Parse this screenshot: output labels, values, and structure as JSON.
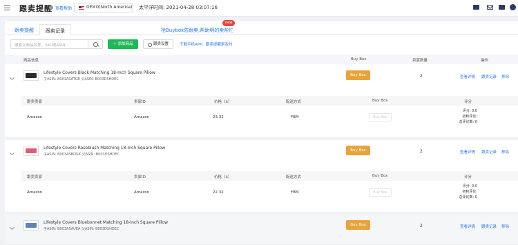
{
  "header": {
    "app_title": "跟卖提醒",
    "help_link": "查看帮助",
    "region": "DEMO(North America)",
    "time_label": "太平洋时间: 2021-04-28 03:07:16"
  },
  "tabs": [
    {
      "label": "跟卖提醒"
    },
    {
      "label": "跟卖记录"
    }
  ],
  "promo": {
    "text": "抢Buybox防跟卖,帮助明的卖帮忙",
    "badge": "new"
  },
  "toolbar": {
    "search_placeholder": "搜索父商品名称、SKU或ASIN",
    "add_button": "添加商品",
    "settings_button": "跟卖设置",
    "app_link": "下载手机APP，跟卖提醒更及时"
  },
  "table_headers": {
    "product_info": "商品信息",
    "buy_box": "Buy Box",
    "seller_count": "卖家数量",
    "actions": "操作"
  },
  "sub_headers": {
    "seller": "跟卖卖家",
    "seller_id": "卖家ID",
    "price": "价格（$）",
    "shipping": "配送方式",
    "buy_box": "Buy Box",
    "rating": "评分"
  },
  "products": [
    {
      "title": "Lifestyle Covers Black Matching 18-Inch Square Pillow",
      "asins": "子ASIN: B003ASATGE   父ASIN: B003DSHDEC",
      "buybox": "Buy Box",
      "seller_count": "2",
      "op_detail": "查看详情",
      "op_record": "跟卖记录",
      "op_remove": "移除",
      "pillow_color": "#2a2a2a",
      "sellers": [
        {
          "name": "Amazon",
          "id": "Amazon",
          "price": "23.32",
          "shipping": "FBM",
          "buybox": "Buy Box",
          "rating": "评分: 0.0",
          "reviews": "初积评论:",
          "total": "总评论数: 0"
        }
      ]
    },
    {
      "title": "Lifestyle Covers Roseblush Matching 18-Inch Square Pillow",
      "asins": "子ASIN: B003ASBDGK   父ASIN: B003DSHDEC",
      "buybox": "Buy Box",
      "seller_count": "2",
      "op_detail": "查看详情",
      "op_record": "跟卖记录",
      "op_remove": "移除",
      "pillow_color": "#d9607a",
      "sellers": [
        {
          "name": "Amazon",
          "id": "Amazon",
          "price": "22.32",
          "shipping": "FBM",
          "buybox": "Buy Box",
          "rating": "评分: 0.0",
          "reviews": "初积评论:",
          "total": "总评论数: 0"
        }
      ]
    },
    {
      "title": "Lifestyle Covers Bluebonnet Matching 18-Inch Square Pillow",
      "asins": "子ASIN: B003ASAUEA   父ASIN: B003DSHDEC",
      "buybox": "Buy Box",
      "seller_count": "2",
      "op_detail": "查看详情",
      "op_record": "跟卖记录",
      "op_remove": "移除",
      "pillow_color": "#5b86b8"
    }
  ],
  "colors": {
    "accent": "#2a7ae2",
    "add_green": "#1fb857",
    "buybox_orange": "#e8a33c",
    "new_badge": "#e8443a"
  }
}
